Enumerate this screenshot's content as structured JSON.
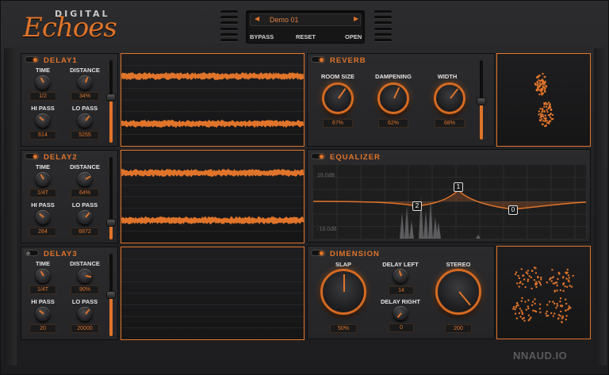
{
  "brand": {
    "logo_small": "DIGITAL",
    "logo_big": "Echoes",
    "footer": "NNAUD.IO"
  },
  "preset": {
    "name": "Demo 01",
    "prev": "◀",
    "next": "▶",
    "bypass": "BYPASS",
    "reset": "RESET",
    "open": "OPEN"
  },
  "delays": [
    {
      "title": "DELAY1",
      "enabled": true,
      "time_label": "TIME",
      "time": "1/2",
      "distance_label": "DISTANCE",
      "distance": "34%",
      "hipass_label": "HI PASS",
      "hipass": "614",
      "lopass_label": "LO PASS",
      "lopass": "5255",
      "level": 0.55
    },
    {
      "title": "DELAY2",
      "enabled": true,
      "time_label": "TIME",
      "time": "1/4T",
      "distance_label": "DISTANCE",
      "distance": "64%",
      "hipass_label": "HI PASS",
      "hipass": "284",
      "lopass_label": "LO PASS",
      "lopass": "6872",
      "level": 0.2
    },
    {
      "title": "DELAY3",
      "enabled": false,
      "time_label": "TIME",
      "time": "1/4T",
      "distance_label": "DISTANCE",
      "distance": "90%",
      "hipass_label": "HI PASS",
      "hipass": "20",
      "lopass_label": "LO PASS",
      "lopass": "20000",
      "level": 0.5
    }
  ],
  "reverb": {
    "title": "REVERB",
    "room_label": "ROOM SIZE",
    "room": "67%",
    "damp_label": "DAMPENING",
    "damp": "62%",
    "width_label": "WIDTH",
    "width": "68%",
    "level": 0.48
  },
  "equalizer": {
    "title": "EQUALIZER",
    "top_db": "18.0dB",
    "bottom_db": "-18.0dB",
    "nodes": [
      "1",
      "2",
      "0"
    ]
  },
  "dimension": {
    "title": "DIMENSION",
    "slap_label": "SLAP",
    "slap": "50%",
    "delay_left_label": "DELAY LEFT",
    "delay_left": "14",
    "delay_right_label": "DELAY RIGHT",
    "delay_right": "0",
    "stereo_label": "STEREO",
    "stereo": "200"
  },
  "colors": {
    "accent": "#e0742a",
    "background": "#232325",
    "display": "#1a1a1b"
  }
}
